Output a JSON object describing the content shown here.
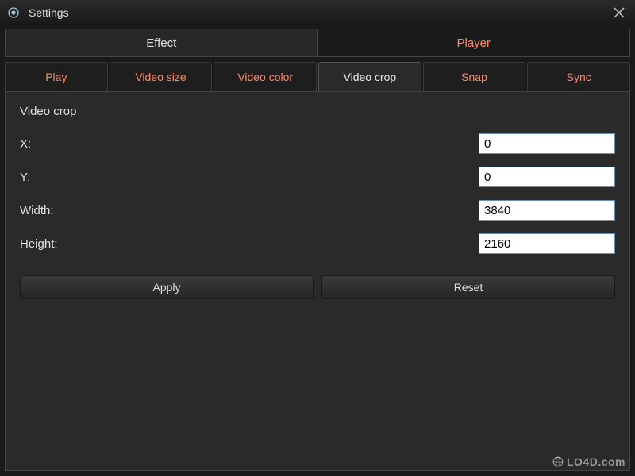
{
  "window": {
    "title": "Settings"
  },
  "mainTabs": {
    "effect": "Effect",
    "player": "Player",
    "active": "effect"
  },
  "subTabs": {
    "play": "Play",
    "videoSize": "Video size",
    "videoColor": "Video color",
    "videoCrop": "Video crop",
    "snap": "Snap",
    "sync": "Sync",
    "active": "videoCrop"
  },
  "panel": {
    "title": "Video crop",
    "fields": {
      "x": {
        "label": "X:",
        "value": "0"
      },
      "y": {
        "label": "Y:",
        "value": "0"
      },
      "width": {
        "label": "Width:",
        "value": "3840"
      },
      "height": {
        "label": "Height:",
        "value": "2160"
      }
    },
    "buttons": {
      "apply": "Apply",
      "reset": "Reset"
    }
  },
  "watermark": "LO4D.com"
}
